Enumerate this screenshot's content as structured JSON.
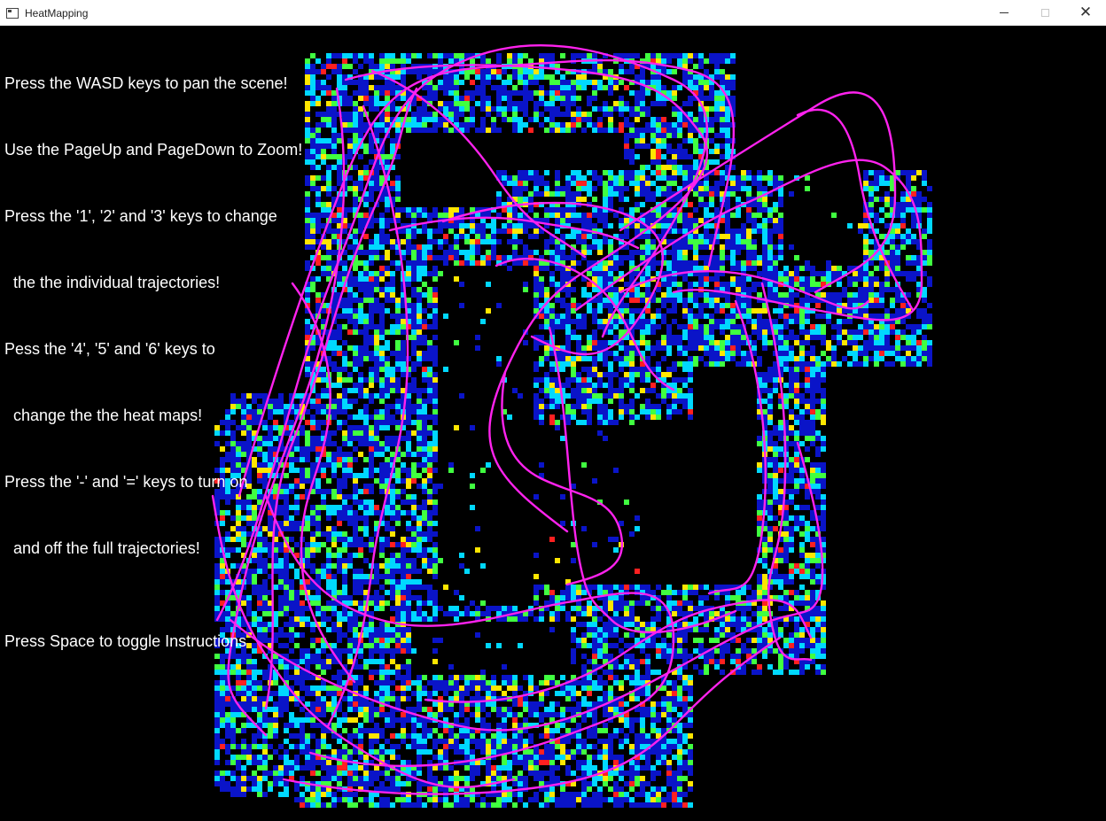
{
  "window": {
    "title": "HeatMapping",
    "controls": {
      "minimize_icon": "minimize-icon",
      "maximize_icon": "maximize-icon",
      "close_icon": "close-icon"
    }
  },
  "instructions": {
    "line1": "Press the WASD keys to pan the scene!",
    "line2": "Use the PageUp and PageDown to Zoom!",
    "line3": "Press the '1', '2' and '3' keys to change",
    "line4": "  the the individual trajectories!",
    "line5": "Pess the '4', '5' and '6' keys to",
    "line6": "  change the the heat maps!",
    "line7": "Press the '-' and '=' keys to turn on",
    "line8": "  and off the full trajectories!",
    "line9": "Press Space to toggle Instructions"
  },
  "colors": {
    "background": "#000000",
    "trajectory": "#ff22ee",
    "heat_low": "#0a14c8",
    "heat_mid": "#00d8ff",
    "heat_high": "#40ff40",
    "heat_peak": "#ffe600",
    "heat_max": "#ff2020"
  }
}
